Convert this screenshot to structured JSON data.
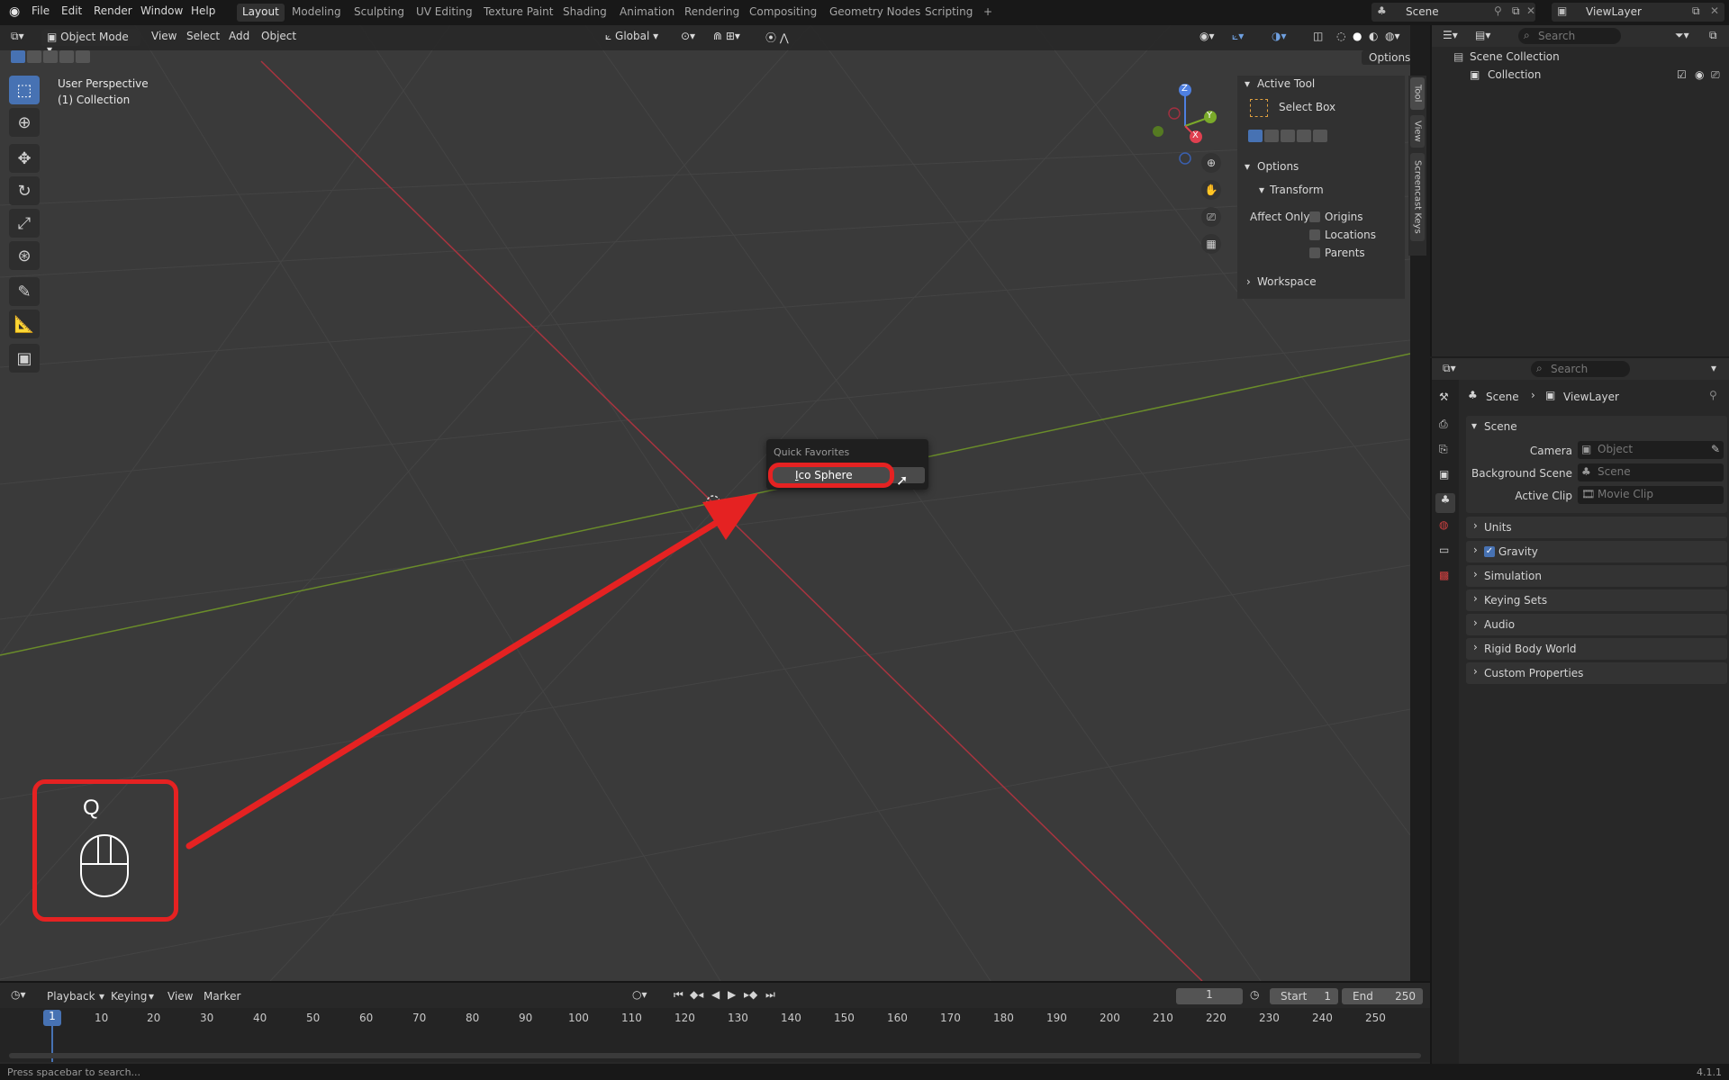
{
  "topbar": {
    "menus": [
      "File",
      "Edit",
      "Render",
      "Window",
      "Help"
    ],
    "workspaces": [
      "Layout",
      "Modeling",
      "Sculpting",
      "UV Editing",
      "Texture Paint",
      "Shading",
      "Animation",
      "Rendering",
      "Compositing",
      "Geometry Nodes",
      "Scripting"
    ],
    "active_workspace": "Layout",
    "add_tab": "+",
    "scene": "Scene",
    "view_layer": "ViewLayer"
  },
  "viewport_header": {
    "mode": "Object Mode",
    "menus": [
      "View",
      "Select",
      "Add",
      "Object"
    ],
    "orientation": "Global",
    "options": "Options"
  },
  "viewport": {
    "perspective": "User Perspective",
    "collection": "(1) Collection",
    "axes": {
      "x": "X",
      "y": "Y",
      "z": "Z"
    }
  },
  "npanel": {
    "active_tool_header": "Active Tool",
    "tool_name": "Select Box",
    "options_header": "Options",
    "transform_header": "Transform",
    "affect_only": "Affect Only",
    "affect_options": [
      "Origins",
      "Locations",
      "Parents"
    ],
    "workspace_header": "Workspace",
    "tabs": [
      "Tool",
      "View",
      "Screencast Keys"
    ]
  },
  "popup": {
    "title": "Quick Favorites",
    "item_accel": "I",
    "item_rest": "co Sphere"
  },
  "overlay": {
    "key": "Q",
    "color": "#e52222"
  },
  "outliner": {
    "search_placeholder": "Search",
    "root": "Scene Collection",
    "child": "Collection"
  },
  "properties": {
    "search_placeholder": "Search",
    "breadcrumb_scene": "Scene",
    "breadcrumb_sep": "›",
    "breadcrumb_layer": "ViewLayer",
    "panel_title": "Scene",
    "camera_label": "Camera",
    "camera_placeholder": "Object",
    "bg_scene_label": "Background Scene",
    "bg_scene_placeholder": "Scene",
    "active_clip_label": "Active Clip",
    "active_clip_placeholder": "Movie Clip",
    "sections": [
      "Units",
      "Gravity",
      "Simulation",
      "Keying Sets",
      "Audio",
      "Rigid Body World",
      "Custom Properties"
    ]
  },
  "timeline": {
    "menus": [
      "Playback",
      "Keying",
      "View",
      "Marker"
    ],
    "current_frame": "1",
    "start_label": "Start",
    "start": "1",
    "end_label": "End",
    "end": "250",
    "ruler": [
      "1",
      "10",
      "20",
      "30",
      "40",
      "50",
      "60",
      "70",
      "80",
      "90",
      "100",
      "110",
      "120",
      "130",
      "140",
      "150",
      "160",
      "170",
      "180",
      "190",
      "200",
      "210",
      "220",
      "230",
      "240",
      "250"
    ]
  },
  "statusbar": {
    "hint": "Press spacebar to search...",
    "version": "4.1.1"
  }
}
